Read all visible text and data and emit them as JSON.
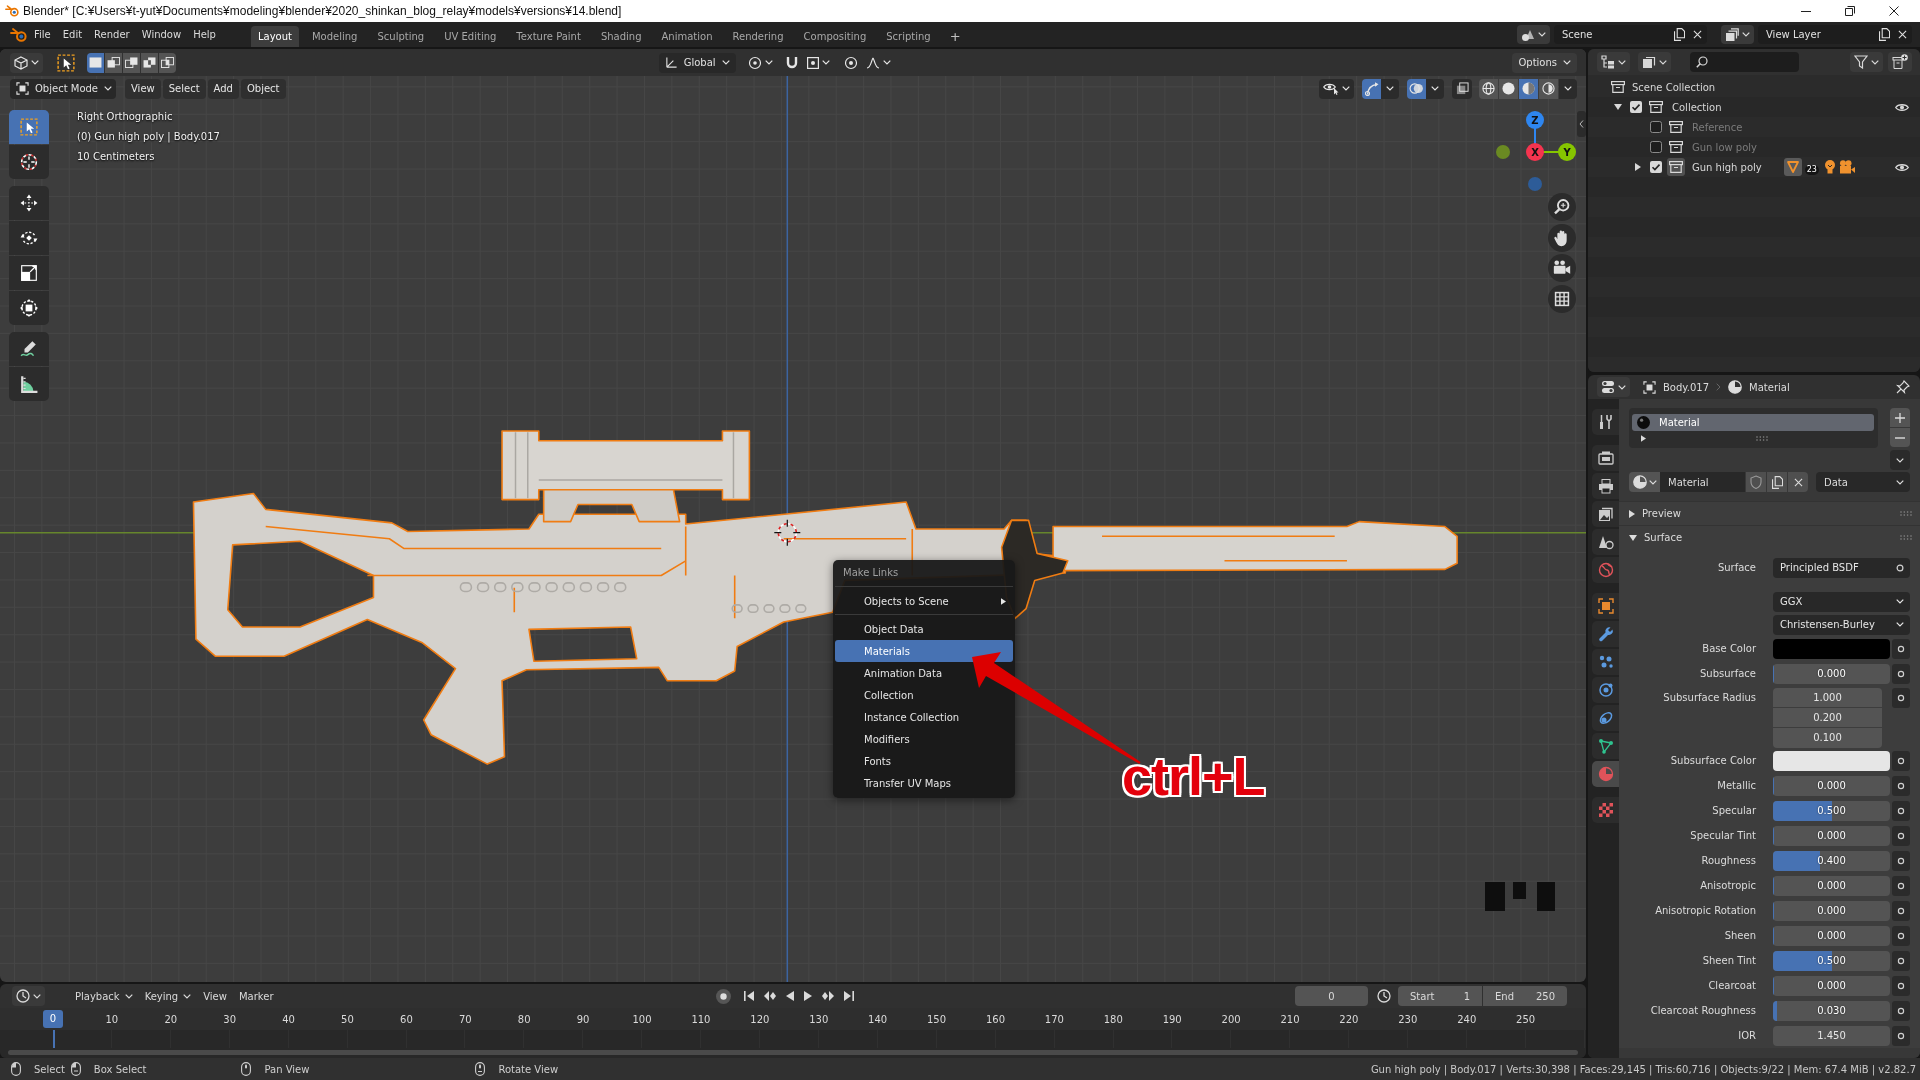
{
  "window": {
    "title": "Blender* [C:¥Users¥t-yut¥Documents¥modeling¥blender¥2020_shinkan_blog_relay¥models¥versions¥14.blend]"
  },
  "menu_bar": {
    "menus": [
      "File",
      "Edit",
      "Render",
      "Window",
      "Help"
    ],
    "workspaces": [
      {
        "label": "Layout",
        "selected": true
      },
      {
        "label": "Modeling",
        "selected": false
      },
      {
        "label": "Sculpting",
        "selected": false
      },
      {
        "label": "UV Editing",
        "selected": false
      },
      {
        "label": "Texture Paint",
        "selected": false
      },
      {
        "label": "Shading",
        "selected": false
      },
      {
        "label": "Animation",
        "selected": false
      },
      {
        "label": "Rendering",
        "selected": false
      },
      {
        "label": "Compositing",
        "selected": false
      },
      {
        "label": "Scripting",
        "selected": false
      }
    ],
    "add_workspace": "+",
    "scene": "Scene",
    "view_layer": "View Layer"
  },
  "viewport": {
    "tool_header": {
      "select_modes": [
        {
          "selected": true
        },
        {
          "selected": false
        },
        {
          "selected": false
        },
        {
          "selected": false
        },
        {
          "selected": false
        }
      ],
      "orientation": "Global",
      "options": "Options"
    },
    "header": {
      "mode": "Object Mode",
      "menus": [
        "View",
        "Select",
        "Add",
        "Object"
      ],
      "gizmos": {
        "on": true
      },
      "overlays": {
        "on": true
      },
      "xray": {
        "on": false
      },
      "shading": [
        {
          "selected": false
        },
        {
          "selected": false
        },
        {
          "selected": true
        },
        {
          "selected": false
        }
      ]
    },
    "toolbar": [
      {
        "tools": [
          {
            "selected": true
          },
          {
            "selected": false
          }
        ]
      },
      {
        "tools": [
          {
            "selected": false
          },
          {
            "selected": false
          },
          {
            "selected": false
          },
          {
            "selected": false
          }
        ]
      },
      {
        "tools": [
          {
            "selected": false
          },
          {
            "selected": false
          }
        ]
      }
    ],
    "info": [
      "Right Orthographic",
      "(0) Gun high poly | Body.017",
      "10 Centimeters"
    ],
    "navigation_gizmo": {
      "axes": [
        "Z",
        "X",
        "Y"
      ]
    },
    "context_menu": {
      "title": "Make Links",
      "groups": [
        {
          "items": [
            {
              "label": "Objects to Scene",
              "submenu": true,
              "selected": false
            }
          ]
        },
        {
          "items": [
            {
              "label": "Object Data",
              "submenu": false,
              "selected": false
            },
            {
              "label": "Materials",
              "submenu": false,
              "selected": true
            },
            {
              "label": "Animation Data",
              "submenu": false,
              "selected": false
            },
            {
              "label": "Collection",
              "submenu": false,
              "selected": false
            },
            {
              "label": "Instance Collection",
              "submenu": false,
              "selected": false
            },
            {
              "label": "Modifiers",
              "submenu": false,
              "selected": false
            },
            {
              "label": "Fonts",
              "submenu": false,
              "selected": false
            },
            {
              "label": "Transfer UV Maps",
              "submenu": false,
              "selected": false
            }
          ]
        }
      ]
    },
    "annotation": {
      "text": "ctrl+L"
    }
  },
  "timeline": {
    "menus": [
      {
        "label": "Playback",
        "kind": "dropdown"
      },
      {
        "label": "Keying",
        "kind": "dropdown"
      },
      {
        "label": "View",
        "kind": "menu"
      },
      {
        "label": "Marker",
        "kind": "menu"
      }
    ],
    "current_frame": "0",
    "start": {
      "label": "Start",
      "value": "1"
    },
    "end": {
      "label": "End",
      "value": "250"
    },
    "playhead": "0",
    "frames": [
      "10",
      "20",
      "30",
      "40",
      "50",
      "60",
      "70",
      "80",
      "90",
      "100",
      "110",
      "120",
      "130",
      "140",
      "150",
      "160",
      "170",
      "180",
      "190",
      "200",
      "210",
      "220",
      "230",
      "240",
      "250"
    ]
  },
  "outliner": {
    "tree": [
      {
        "label": "Scene Collection",
        "children": [
          {
            "label": "Collection",
            "checked": true,
            "expanded": true,
            "visible": true,
            "active": false,
            "children": [
              {
                "label": "Reference",
                "checked": false,
                "visible": false,
                "active": false
              },
              {
                "label": "Gun low poly",
                "checked": false,
                "visible": false,
                "active": false
              },
              {
                "label": "Gun high poly",
                "checked": true,
                "expanded": false,
                "visible": true,
                "active": true,
                "badge": "23"
              }
            ]
          }
        ]
      }
    ]
  },
  "properties": {
    "object": "Body.017",
    "context": "Material",
    "tabs": [
      {
        "selected": false
      },
      {
        "selected": false
      },
      {
        "selected": false
      },
      {
        "selected": false
      },
      {
        "selected": false
      },
      {
        "selected": false
      },
      {
        "selected": false
      },
      {
        "selected": false
      },
      {
        "selected": false
      },
      {
        "selected": false
      },
      {
        "selected": false
      },
      {
        "selected": false
      },
      {
        "selected": true
      },
      {
        "selected": false
      }
    ],
    "material_slots": [
      {
        "label": "Material",
        "selected": true
      }
    ],
    "material": {
      "name": "Material",
      "link": "Data"
    },
    "panels": [
      {
        "label": "Preview",
        "expanded": false
      },
      {
        "label": "Surface",
        "expanded": true,
        "inputs": [
          {
            "kind": "shader",
            "label": "Surface",
            "value": "Principled BSDF"
          },
          {
            "kind": "dropdown",
            "value": "GGX"
          },
          {
            "kind": "dropdown",
            "value": "Christensen-Burley"
          },
          {
            "kind": "color",
            "label": "Base Color",
            "color": "#000000"
          },
          {
            "kind": "slider",
            "label": "Subsurface",
            "value": "0.000",
            "level": 0
          },
          {
            "kind": "vector",
            "label": "Subsurface Radius",
            "values": [
              "1.000",
              "0.200",
              "0.100"
            ]
          },
          {
            "kind": "color",
            "label": "Subsurface Color",
            "color": "#e6e6e6"
          },
          {
            "kind": "slider",
            "label": "Metallic",
            "value": "0.000",
            "level": 0
          },
          {
            "kind": "slider",
            "label": "Specular",
            "value": "0.500",
            "level": 0.5
          },
          {
            "kind": "slider",
            "label": "Specular Tint",
            "value": "0.000",
            "level": 0
          },
          {
            "kind": "slider",
            "label": "Roughness",
            "value": "0.400",
            "level": 0.4
          },
          {
            "kind": "slider",
            "label": "Anisotropic",
            "value": "0.000",
            "level": 0
          },
          {
            "kind": "slider",
            "label": "Anisotropic Rotation",
            "value": "0.000",
            "level": 0
          },
          {
            "kind": "slider",
            "label": "Sheen",
            "value": "0.000",
            "level": 0
          },
          {
            "kind": "slider",
            "label": "Sheen Tint",
            "value": "0.500",
            "level": 0.5
          },
          {
            "kind": "slider",
            "label": "Clearcoat",
            "value": "0.000",
            "level": 0
          },
          {
            "kind": "slider",
            "label": "Clearcoat Roughness",
            "value": "0.030",
            "level": 0.03
          },
          {
            "kind": "number",
            "label": "IOR",
            "value": "1.450"
          }
        ]
      }
    ]
  },
  "status_bar": {
    "hints": [
      "Select",
      "Box Select",
      "Pan View",
      "Rotate View"
    ],
    "stats": "Gun high poly | Body.017 | Verts:30,398 | Faces:29,145 | Tris:60,716 | Objects:9/22 | Mem: 67.4 MiB | v2.82.7"
  }
}
